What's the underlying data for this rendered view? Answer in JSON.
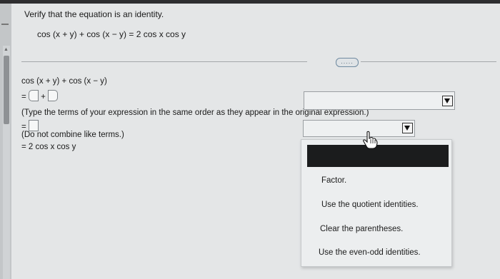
{
  "problem": {
    "prompt": "Verify that the equation is an identity.",
    "equation": "cos (x + y) + cos (x − y) = 2 cos x cos y"
  },
  "more_button": {
    "label": "....."
  },
  "work": {
    "step0": "cos (x + y) + cos (x − y)",
    "step1_prefix": "=",
    "step1_plus": "+",
    "instruction1": "(Type the terms of your expression in the same order as they appear in the original expression.)",
    "step2_prefix": "=",
    "instruction2": "(Do not combine like terms.)",
    "step3": "= 2 cos x cos y"
  },
  "dropdown_menu": {
    "selected": "",
    "options": [
      "Factor.",
      "Use the quotient identities.",
      "Clear the parentheses.",
      "Use the even-odd identities."
    ]
  },
  "icons": {
    "dropdown_arrow": "triangle-down-icon",
    "cursor": "hand-pointer-icon"
  }
}
